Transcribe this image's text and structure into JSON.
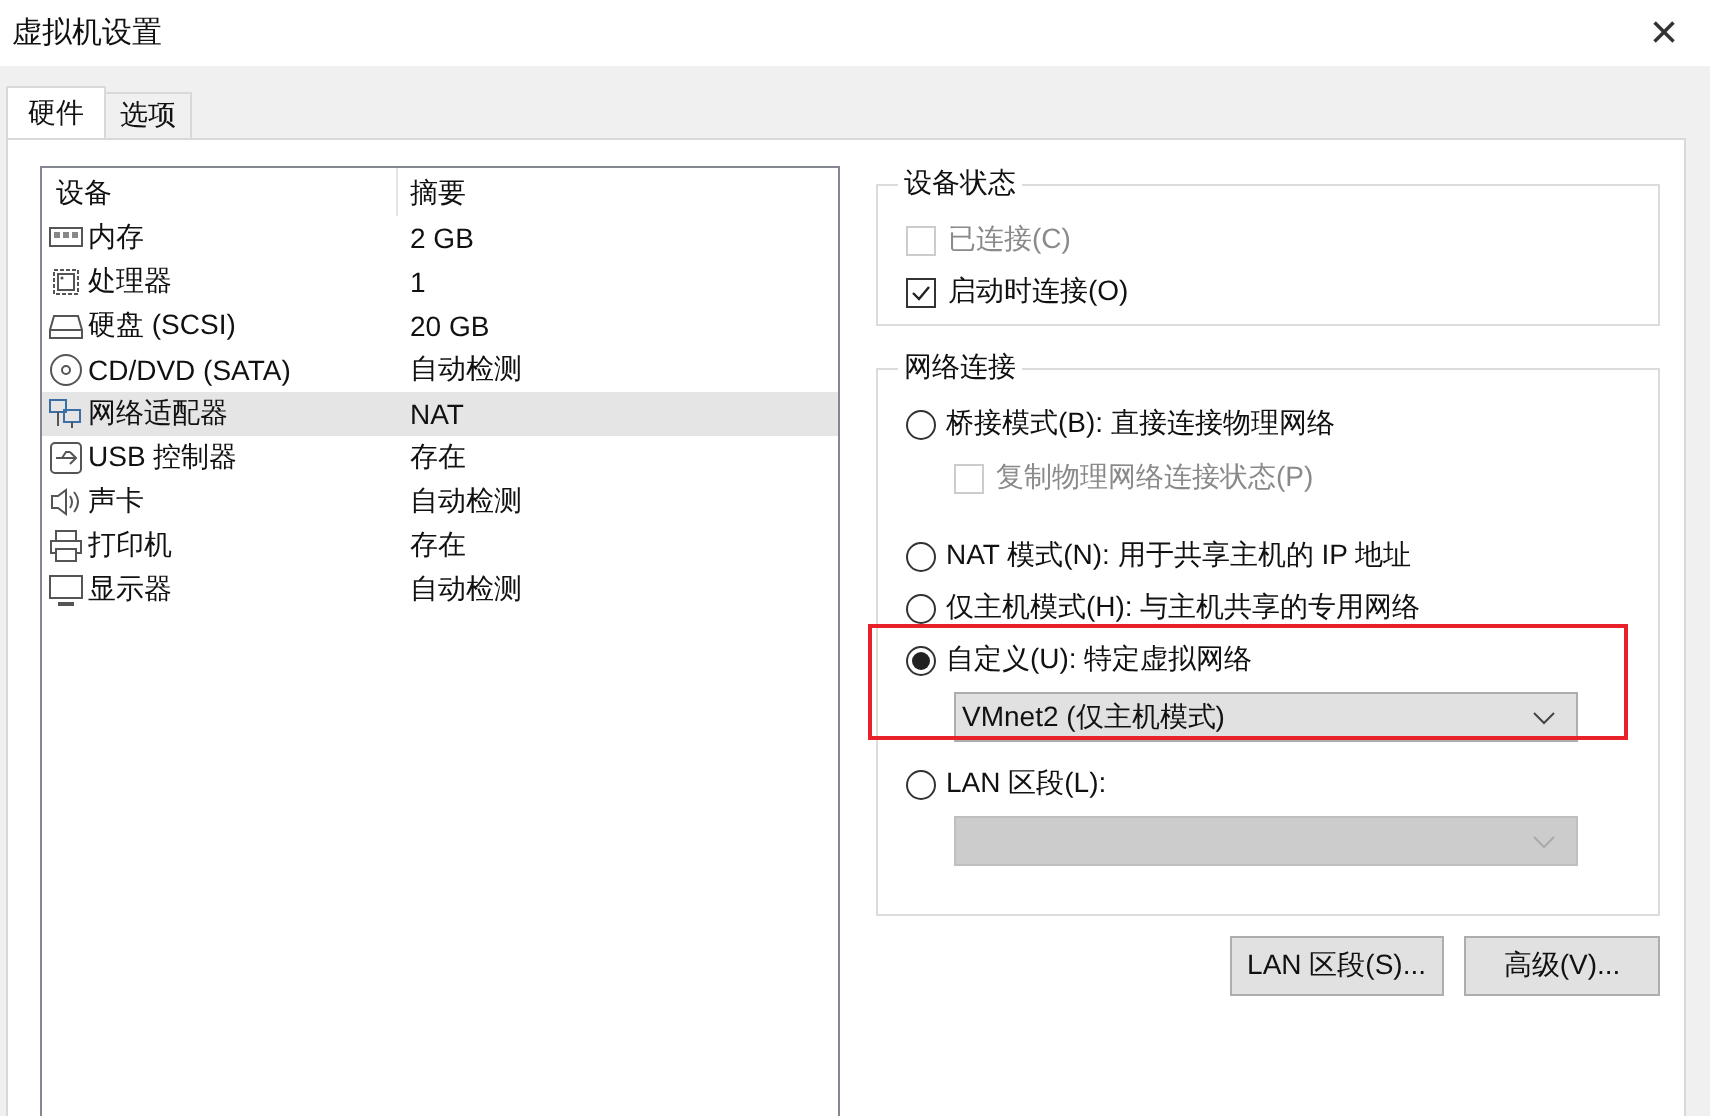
{
  "window": {
    "title": "虚拟机设置",
    "close": "×"
  },
  "tabs": [
    {
      "label": "硬件",
      "selected": true
    },
    {
      "label": "选项",
      "selected": false
    }
  ],
  "devices": {
    "columns": [
      "设备",
      "摘要"
    ],
    "rows": [
      {
        "name": "内存",
        "summary": "2 GB",
        "selected": false
      },
      {
        "name": "处理器",
        "summary": "1",
        "selected": false
      },
      {
        "name": "硬盘 (SCSI)",
        "summary": "20 GB",
        "selected": false
      },
      {
        "name": "CD/DVD (SATA)",
        "summary": "自动检测",
        "selected": false
      },
      {
        "name": "网络适配器",
        "summary": "NAT",
        "selected": true
      },
      {
        "name": "USB 控制器",
        "summary": "存在",
        "selected": false
      },
      {
        "name": "声卡",
        "summary": "自动检测",
        "selected": false
      },
      {
        "name": "打印机",
        "summary": "存在",
        "selected": false
      },
      {
        "name": "显示器",
        "summary": "自动检测",
        "selected": false
      }
    ]
  },
  "device_status": {
    "title": "设备状态",
    "items": [
      {
        "label": "已连接(C)",
        "checked": false,
        "disabled": true
      },
      {
        "label": "启动时连接(O)",
        "checked": true,
        "disabled": false
      }
    ]
  },
  "network": {
    "title": "网络连接",
    "options": [
      {
        "label": "桥接模式(B): 直接连接物理网络",
        "selected": false,
        "highlighted": false,
        "sub": {
          "kind": "checkbox",
          "label": "复制物理网络连接状态(P)",
          "checked": false,
          "disabled": true
        }
      },
      {
        "label": "NAT 模式(N): 用于共享主机的 IP 地址",
        "selected": false,
        "highlighted": false
      },
      {
        "label": "仅主机模式(H): 与主机共享的专用网络",
        "selected": false,
        "highlighted": false
      },
      {
        "label": "自定义(U): 特定虚拟网络",
        "selected": true,
        "highlighted": true,
        "sub": {
          "kind": "dropdown",
          "value": "VMnet2 (仅主机模式)",
          "disabled": false
        }
      },
      {
        "label": "LAN 区段(L):",
        "selected": false,
        "highlighted": false,
        "sub": {
          "kind": "dropdown",
          "disabled": true
        }
      }
    ]
  },
  "buttons": [
    "LAN 区段(S)...",
    "高级(V)..."
  ]
}
